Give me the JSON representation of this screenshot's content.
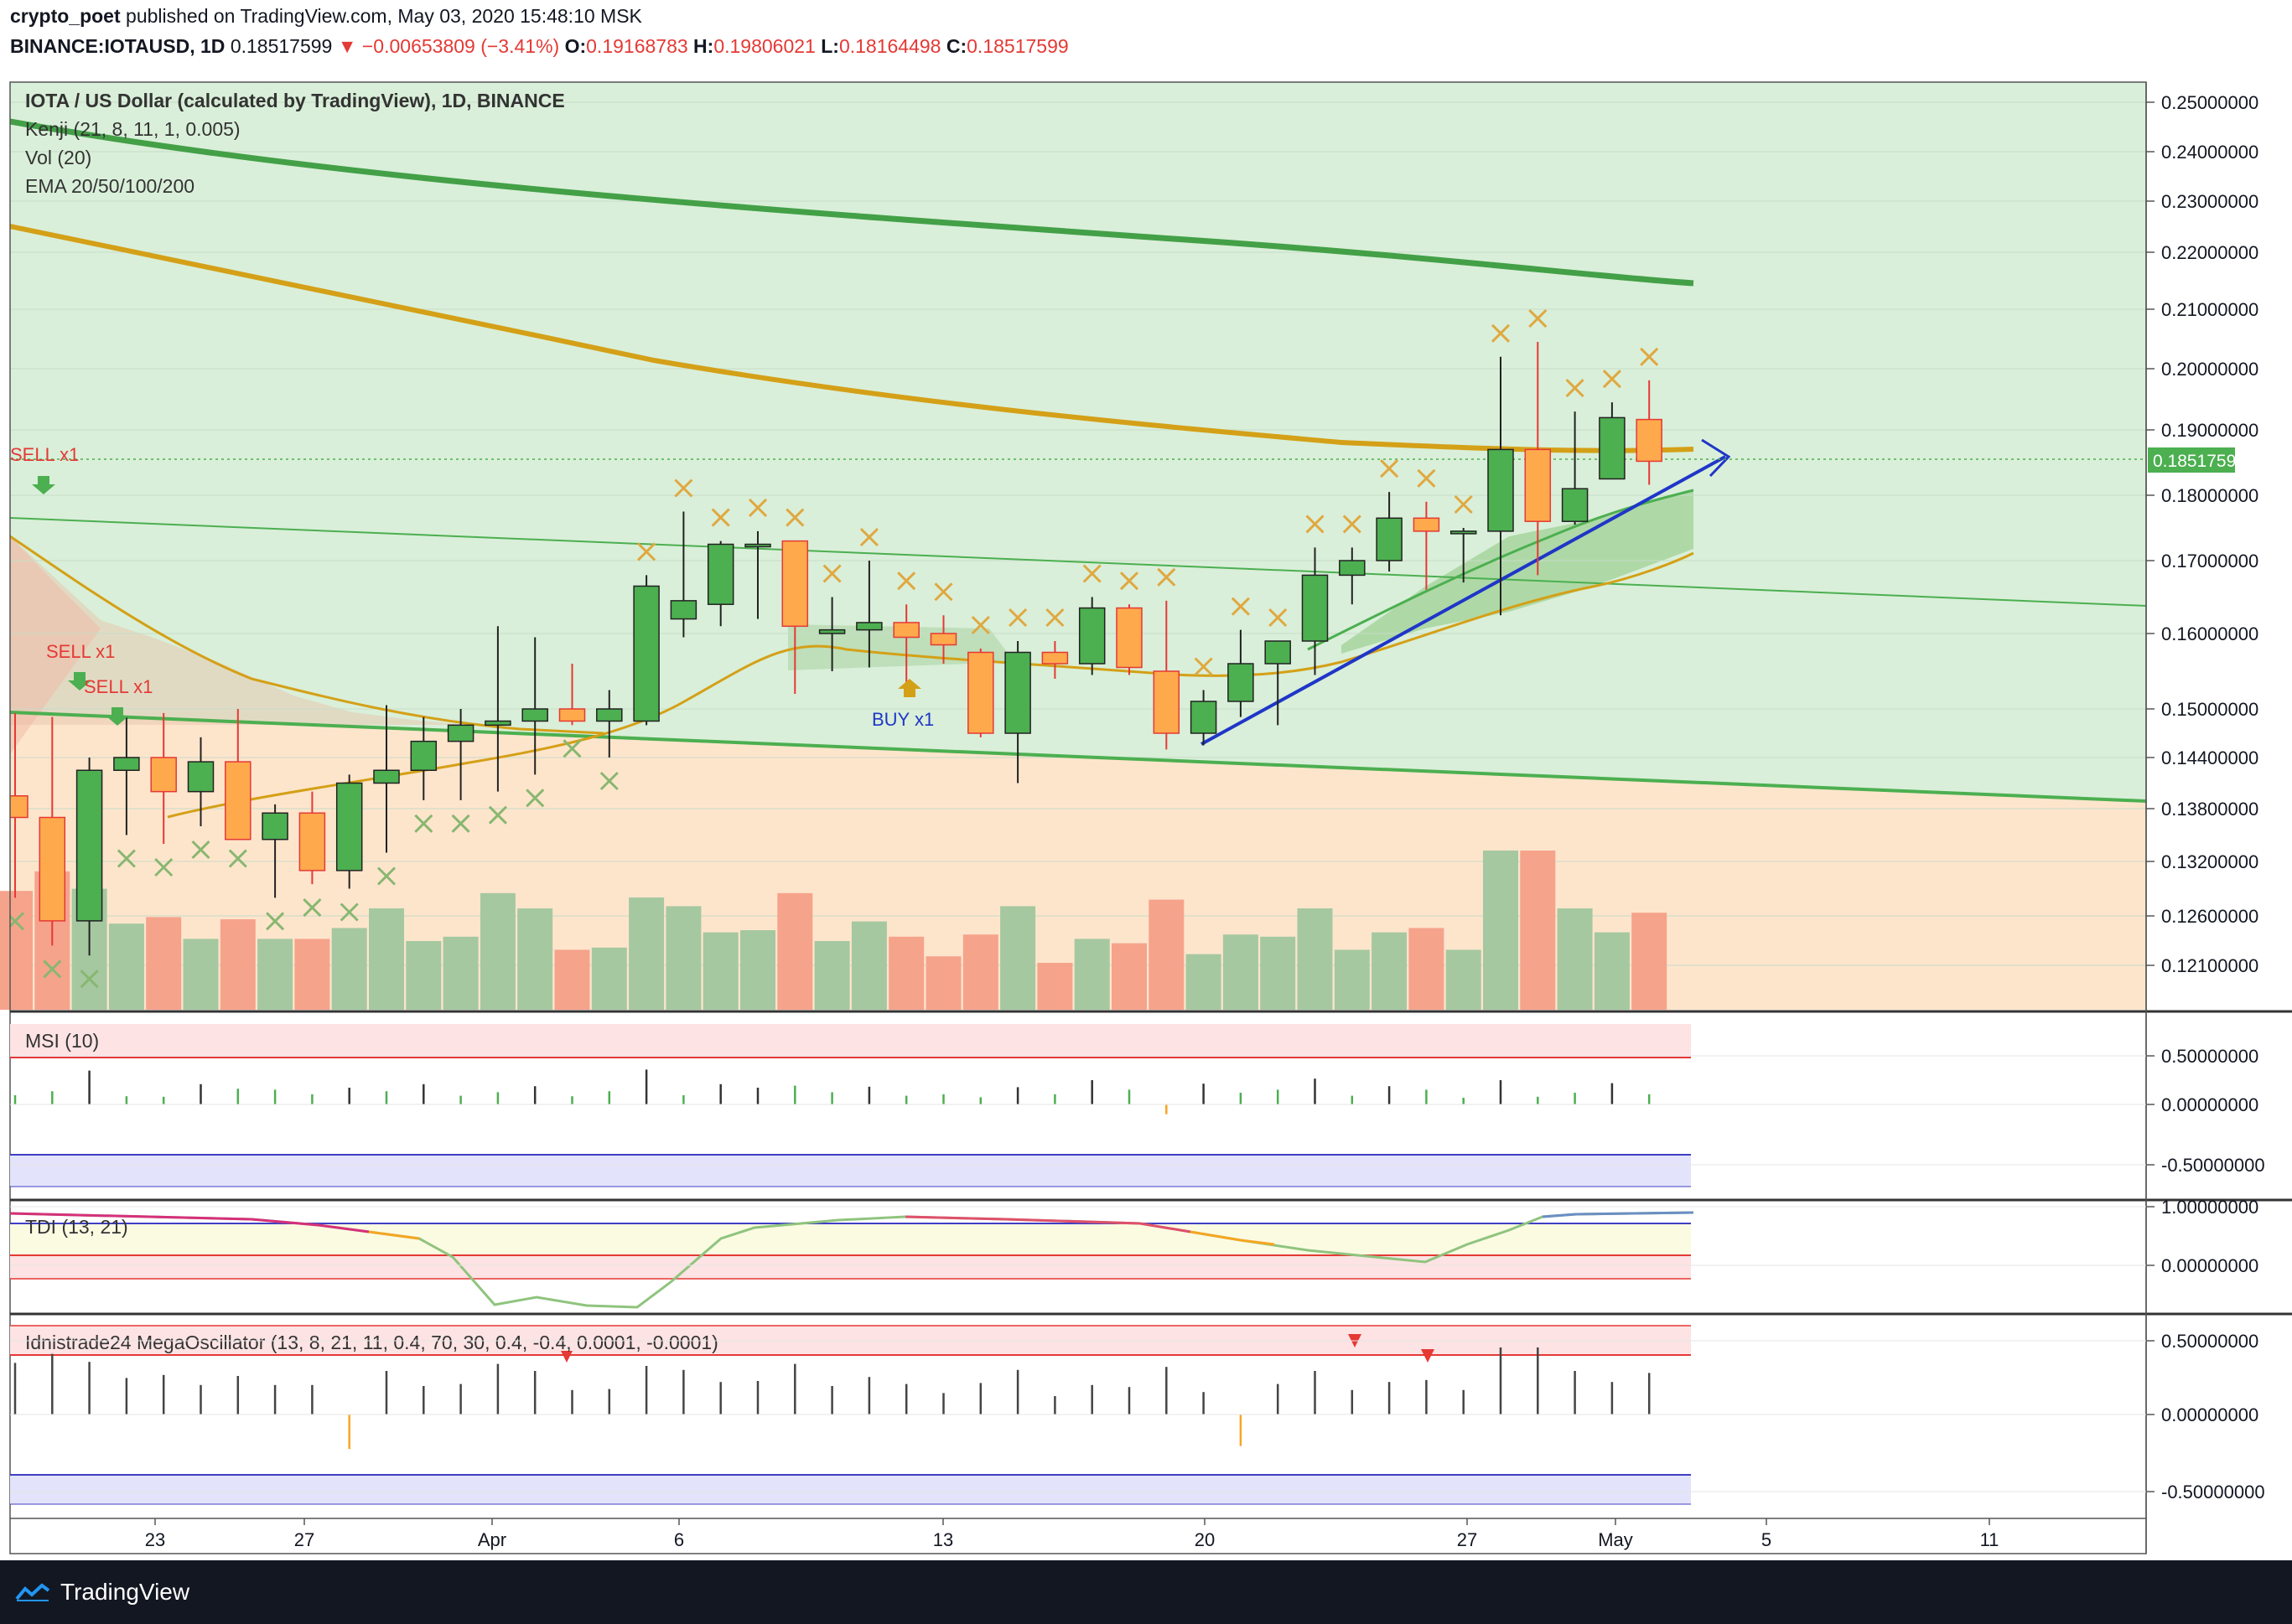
{
  "header": {
    "publisher": "crypto_poet",
    "published_text": "published on TradingView.com, May 03, 2020 15:48:10 MSK",
    "symbol": "BINANCE:IOTAUSD, 1D",
    "last": "0.18517599",
    "change": "▼ −0.00653809 (−3.41%)",
    "o_label": "O:",
    "o_value": "0.19168783",
    "h_label": "H:",
    "h_value": "0.19806021",
    "l_label": "L:",
    "l_value": "0.18164498",
    "c_label": "C:",
    "c_value": "0.18517599"
  },
  "legend": {
    "title": "IOTA / US Dollar (calculated by TradingView), 1D, BINANCE",
    "line2": "Kenji (21, 8, 11, 1, 0.005)",
    "line3": "Vol (20)",
    "line4": "EMA 20/50/100/200"
  },
  "signals": {
    "sell1": "SELL x1",
    "sell2": "SELL x1",
    "sell3": "SELL x1",
    "buy1": "BUY x1"
  },
  "panes": {
    "msi": "MSI (10)",
    "tdi": "TDI (13, 21)",
    "mega": "Idnistrade24 MegaOscillator (13, 8, 21, 11, 0.4, 70, 30, 0.4, -0.4, 0.0001, -0.0001)"
  },
  "price_axis": [
    "0.25000000",
    "0.24000000",
    "0.23000000",
    "0.22000000",
    "0.21000000",
    "0.20000000",
    "0.19000000",
    "0.18000000",
    "0.17000000",
    "0.16000000",
    "0.15000000",
    "0.14400000",
    "0.13800000",
    "0.13200000",
    "0.12600000",
    "0.12100000"
  ],
  "last_price_label": "0.18517599",
  "msi_axis": [
    "0.50000000",
    "0.00000000",
    "-0.50000000"
  ],
  "tdi_axis": [
    "1.00000000",
    "0.00000000"
  ],
  "mega_axis": [
    "0.50000000",
    "0.00000000",
    "-0.50000000"
  ],
  "time_axis": [
    "23",
    "27",
    "Apr",
    "6",
    "13",
    "20",
    "27",
    "May",
    "5",
    "11"
  ],
  "footer_brand": "TradingView",
  "colors": {
    "up": "#4caf50",
    "down": "#ffa94d",
    "wick": "#e53935",
    "ema_green": "#43a047",
    "ema_gold": "#d4a017",
    "vol_up": "#a5c8a0",
    "vol_down": "#f6a38c",
    "bg_green": "#d9efd9",
    "bg_orange": "#fde5cc",
    "trend_blue": "#1f36c8",
    "last_price": "#4caf50"
  },
  "chart_data": {
    "type": "candlestick",
    "x": [
      "Mar 20",
      "Mar 21",
      "Mar 22",
      "Mar 23",
      "Mar 24",
      "Mar 25",
      "Mar 26",
      "Mar 27",
      "Mar 28",
      "Mar 29",
      "Mar 30",
      "Mar 31",
      "Apr 1",
      "Apr 2",
      "Apr 3",
      "Apr 4",
      "Apr 5",
      "Apr 6",
      "Apr 7",
      "Apr 8",
      "Apr 9",
      "Apr 10",
      "Apr 11",
      "Apr 12",
      "Apr 13",
      "Apr 14",
      "Apr 15",
      "Apr 16",
      "Apr 17",
      "Apr 18",
      "Apr 19",
      "Apr 20",
      "Apr 21",
      "Apr 22",
      "Apr 23",
      "Apr 24",
      "Apr 25",
      "Apr 26",
      "Apr 27",
      "Apr 28",
      "Apr 29",
      "Apr 30",
      "May 1",
      "May 2",
      "May 3"
    ],
    "candles": [
      [
        0.1385,
        0.149,
        0.124,
        0.148
      ],
      [
        0.148,
        0.177,
        0.124,
        0.1395
      ],
      [
        0.1395,
        0.1495,
        0.128,
        0.137
      ],
      [
        0.137,
        0.149,
        0.123,
        0.1255
      ],
      [
        0.1255,
        0.144,
        0.122,
        0.1425
      ],
      [
        0.1425,
        0.149,
        0.135,
        0.144
      ],
      [
        0.144,
        0.1495,
        0.134,
        0.14
      ],
      [
        0.14,
        0.1465,
        0.136,
        0.1435
      ],
      [
        0.1435,
        0.15,
        0.135,
        0.1345
      ],
      [
        0.1345,
        0.1385,
        0.128,
        0.1375
      ],
      [
        0.1375,
        0.14,
        0.1295,
        0.131
      ],
      [
        0.131,
        0.142,
        0.129,
        0.141
      ],
      [
        0.141,
        0.1505,
        0.133,
        0.1425
      ],
      [
        0.1425,
        0.149,
        0.139,
        0.146
      ],
      [
        0.146,
        0.15,
        0.139,
        0.148
      ],
      [
        0.148,
        0.161,
        0.14,
        0.1485
      ],
      [
        0.1485,
        0.1595,
        0.142,
        0.15
      ],
      [
        0.15,
        0.156,
        0.148,
        0.1485
      ],
      [
        0.1485,
        0.1525,
        0.144,
        0.15
      ],
      [
        0.1485,
        0.168,
        0.148,
        0.1665
      ],
      [
        0.162,
        0.1775,
        0.1595,
        0.1645
      ],
      [
        0.164,
        0.173,
        0.161,
        0.1725
      ],
      [
        0.1725,
        0.1745,
        0.162,
        0.1725
      ],
      [
        0.173,
        0.173,
        0.152,
        0.161
      ],
      [
        0.16,
        0.165,
        0.155,
        0.1605
      ],
      [
        0.1605,
        0.17,
        0.1555,
        0.1615
      ],
      [
        0.1615,
        0.164,
        0.153,
        0.1595
      ],
      [
        0.16,
        0.1625,
        0.156,
        0.1585
      ],
      [
        0.1575,
        0.158,
        0.1465,
        0.147
      ],
      [
        0.147,
        0.159,
        0.141,
        0.1575
      ],
      [
        0.1575,
        0.159,
        0.154,
        0.156
      ],
      [
        0.156,
        0.165,
        0.1545,
        0.1635
      ],
      [
        0.1635,
        0.164,
        0.1545,
        0.1555
      ],
      [
        0.155,
        0.1645,
        0.145,
        0.147
      ],
      [
        0.147,
        0.1525,
        0.1455,
        0.151
      ],
      [
        0.151,
        0.1605,
        0.149,
        0.156
      ],
      [
        0.156,
        0.159,
        0.148,
        0.159
      ],
      [
        0.159,
        0.172,
        0.1545,
        0.168
      ],
      [
        0.168,
        0.172,
        0.164,
        0.17
      ],
      [
        0.17,
        0.1805,
        0.1685,
        0.1765
      ],
      [
        0.1765,
        0.179,
        0.166,
        0.1745
      ],
      [
        0.1745,
        0.175,
        0.167,
        0.1745
      ],
      [
        0.1745,
        0.202,
        0.1625,
        0.187
      ],
      [
        0.187,
        0.2045,
        0.168,
        0.176
      ],
      [
        0.176,
        0.193,
        0.1755,
        0.181
      ],
      [
        0.1825,
        0.1945,
        0.1825,
        0.192
      ],
      [
        0.1917,
        0.1981,
        0.1816,
        0.1852
      ]
    ],
    "ylim": [
      0.115,
      0.255
    ]
  }
}
